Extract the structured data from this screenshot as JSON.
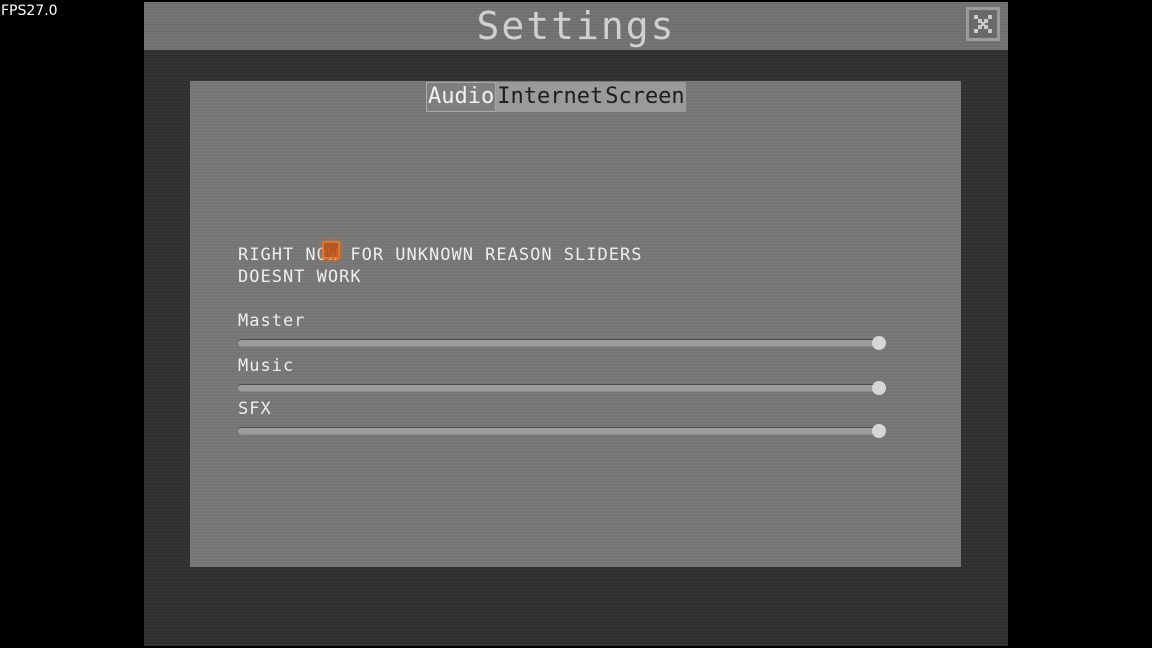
{
  "hud": {
    "fps": "FPS27.0"
  },
  "window": {
    "title": "Settings",
    "close_icon": "close-icon"
  },
  "tabs": [
    {
      "label": "Audio",
      "active": true
    },
    {
      "label": "Internet",
      "active": false
    },
    {
      "label": "Screen",
      "active": false
    }
  ],
  "audio": {
    "notice": "RIGHT NOW FOR UNKNOWN REASON SLIDERS\nDOESNT WORK",
    "sliders": [
      {
        "label": "Master",
        "value": 1.0
      },
      {
        "label": "Music",
        "value": 1.0
      },
      {
        "label": "SFX",
        "value": 1.0
      }
    ]
  }
}
